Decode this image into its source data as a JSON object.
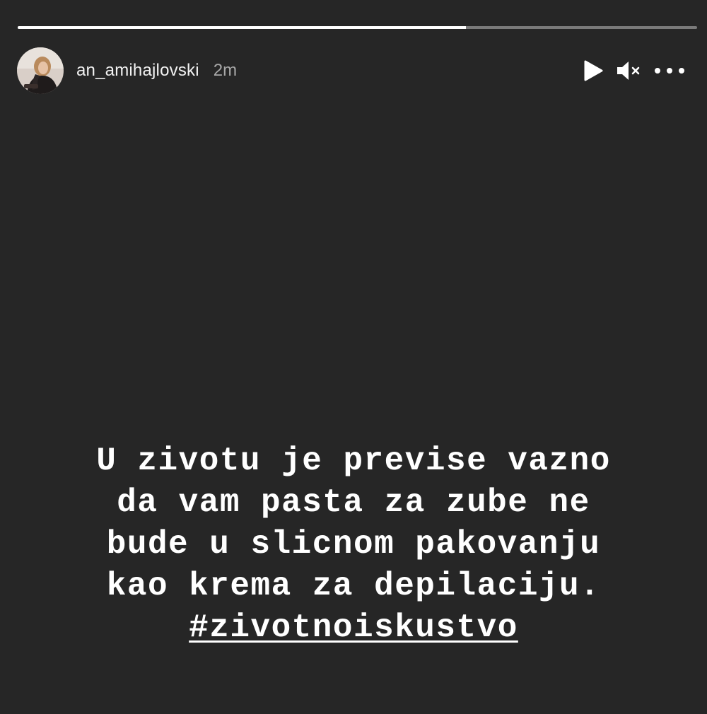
{
  "story": {
    "progress": 0.66,
    "username": "an_amihajlovski",
    "timestamp": "2m",
    "controls": {
      "play_icon": "play-icon",
      "mute_icon": "speaker-muted-icon",
      "more_icon": "more-horizontal-icon"
    },
    "caption": {
      "lines": [
        "U zivotu je previse vazno",
        "da vam pasta za zube ne",
        "bude u slicnom pakovanju",
        "kao krema za depilaciju."
      ],
      "hashtag": "#zivotnoiskustvo"
    },
    "colors": {
      "background": "#262626",
      "progress_track": "#7a7a7a",
      "progress_fill": "#ffffff",
      "text": "#ffffff",
      "timestamp": "#a8a8a8"
    }
  }
}
